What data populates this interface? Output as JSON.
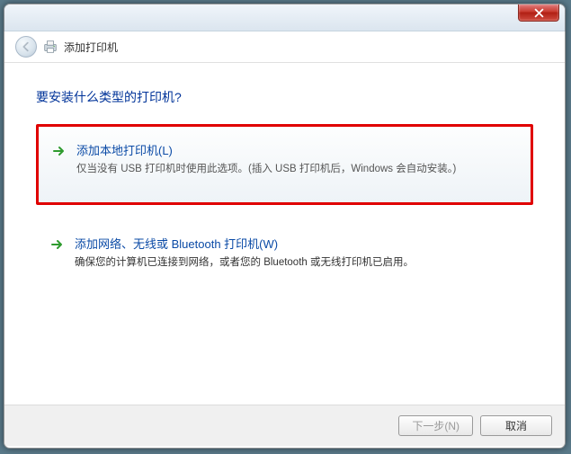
{
  "window": {
    "title": "添加打印机"
  },
  "page": {
    "heading": "要安装什么类型的打印机?"
  },
  "options": {
    "local": {
      "title": "添加本地打印机(L)",
      "desc": "仅当没有 USB 打印机时使用此选项。(插入 USB 打印机后，Windows 会自动安装。)"
    },
    "network": {
      "title": "添加网络、无线或 Bluetooth 打印机(W)",
      "desc": "确保您的计算机已连接到网络，或者您的 Bluetooth 或无线打印机已启用。"
    }
  },
  "buttons": {
    "next": "下一步(N)",
    "cancel": "取消"
  }
}
